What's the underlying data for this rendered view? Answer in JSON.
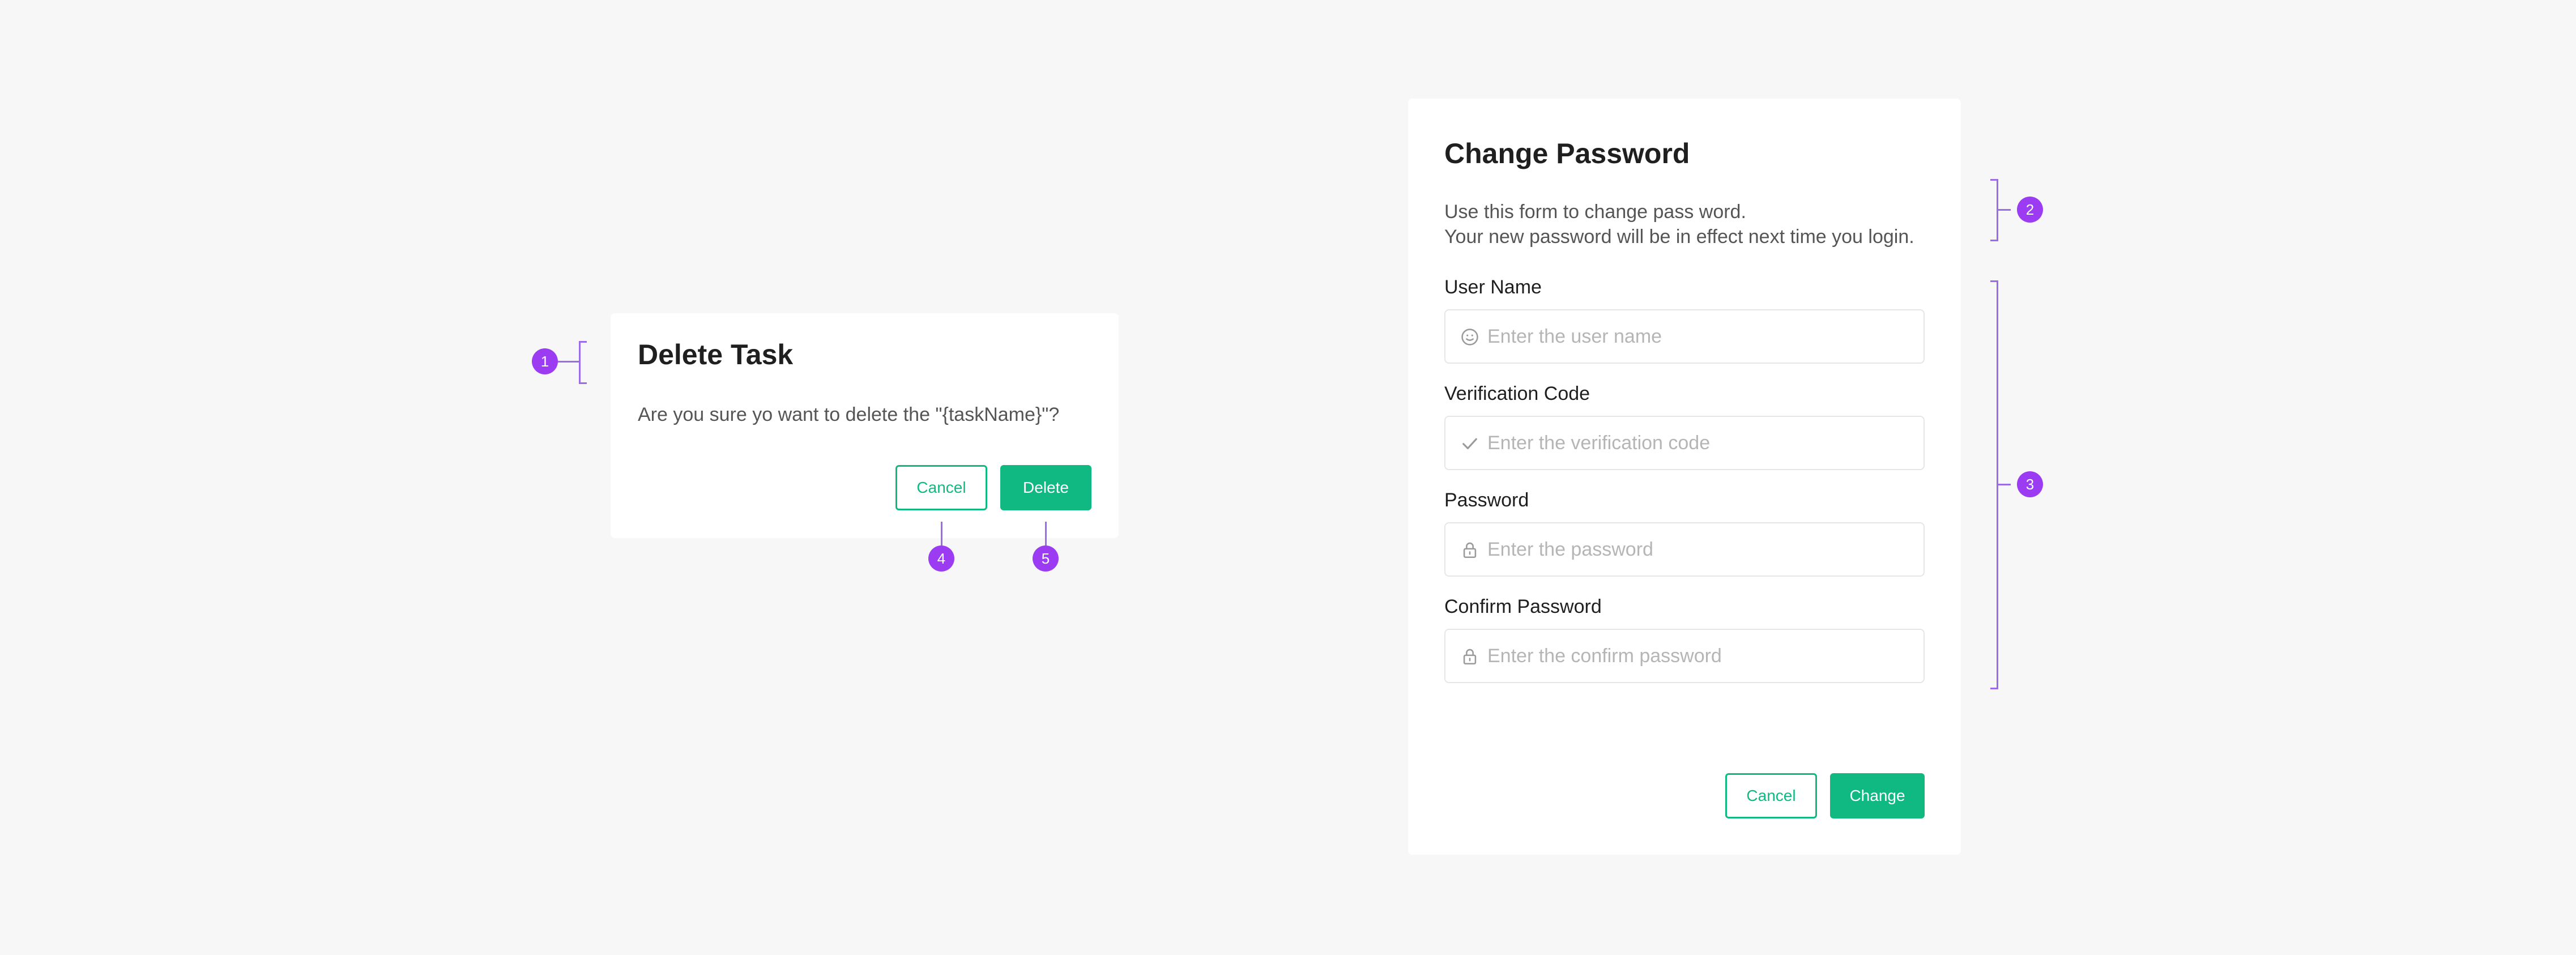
{
  "delete_dialog": {
    "title": "Delete Task",
    "message": "Are you sure yo want to delete the \"{taskName}\"?",
    "cancel_label": "Cancel",
    "delete_label": "Delete"
  },
  "change_password_dialog": {
    "title": "Change Password",
    "description_line1": "Use this form to change pass word.",
    "description_line2": "Your new password will be in effect next time you login.",
    "fields": [
      {
        "label": "User Name",
        "placeholder": "Enter the user name",
        "icon": "smiley-icon",
        "value": ""
      },
      {
        "label": "Verification Code",
        "placeholder": "Enter the verification code",
        "icon": "check-icon",
        "value": ""
      },
      {
        "label": "Password",
        "placeholder": "Enter the password",
        "icon": "lock-icon",
        "value": ""
      },
      {
        "label": "Confirm Password",
        "placeholder": "Enter the confirm password",
        "icon": "lock-icon",
        "value": ""
      }
    ],
    "cancel_label": "Cancel",
    "change_label": "Change"
  },
  "annotations": [
    "1",
    "2",
    "3",
    "4",
    "5"
  ],
  "colors": {
    "accent": "#10b981",
    "annotation": "#9b3cf3",
    "background": "#f7f7f7"
  }
}
